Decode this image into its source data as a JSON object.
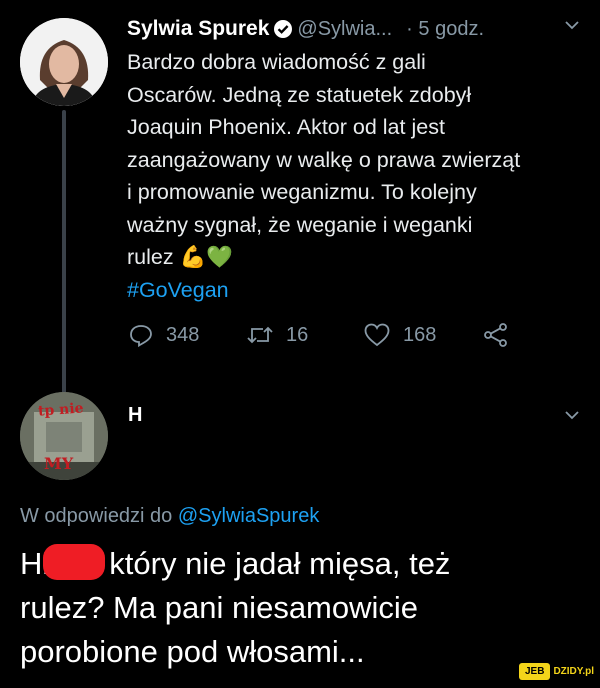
{
  "tweet": {
    "author_name": "Sylwia Spurek",
    "handle": "@Sylwia...",
    "time": "· 5 godz.",
    "text_lines": [
      "Bardzo dobra wiadomość z gali",
      "Oscarów. Jedną ze statuetek zdobył",
      "Joaquin Phoenix. Aktor od lat jest",
      "zaangażowany w walkę o prawa zwierząt",
      "i promowanie weganizmu. To kolejny",
      "ważny sygnał, że weganie i weganki",
      "rulez"
    ],
    "emojis": [
      "💪",
      "💚"
    ],
    "hashtag": "#GoVegan",
    "replies_count": "348",
    "retweets_count": "16",
    "likes_count": "168"
  },
  "reply": {
    "author_name": "H",
    "avatar_text_top": "tp nie",
    "avatar_text_bottom": "MY",
    "replying_to_prefix": "W odpowiedzi do",
    "replying_to_handle": "@SylwiaSpurek",
    "line1_start": "Hi",
    "line1_end": "który nie jadał mięsa, też",
    "line2": "rulez? Ma pani niesamowicie",
    "line3": "porobione pod włosami..."
  },
  "watermark": {
    "part1": "JEB",
    "part2": "DZIDY.pl"
  },
  "colors": {
    "background": "#000000",
    "link": "#1da1f2",
    "muted": "#8899a6",
    "redaction": "#ef1d25"
  }
}
